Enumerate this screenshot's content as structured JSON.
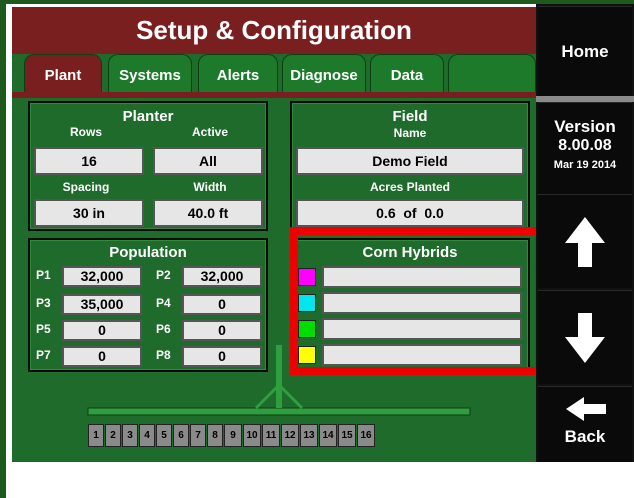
{
  "title": "Setup & Configuration",
  "tabs": [
    {
      "label": "Plant",
      "active": true
    },
    {
      "label": "Systems",
      "active": false
    },
    {
      "label": "Alerts",
      "active": false
    },
    {
      "label": "Diagnose",
      "active": false
    },
    {
      "label": "Data",
      "active": false
    },
    {
      "label": "",
      "active": false
    }
  ],
  "sidebar": {
    "home": "Home",
    "version_label": "Version",
    "version_number": "8.00.08",
    "version_date": "Mar 19 2014",
    "up_icon": "arrow-up-icon",
    "down_icon": "arrow-down-icon",
    "back_icon": "arrow-left-icon",
    "back": "Back"
  },
  "planter": {
    "title": "Planter",
    "rows_label": "Rows",
    "rows_value": "16",
    "active_label": "Active",
    "active_value": "All",
    "spacing_label": "Spacing",
    "spacing_value": "30 in",
    "width_label": "Width",
    "width_value": "40.0 ft"
  },
  "field": {
    "title": "Field",
    "name_label": "Name",
    "name_value": "Demo Field",
    "acres_label": "Acres Planted",
    "acres_value": "0.6  of  0.0"
  },
  "population": {
    "title": "Population",
    "items": [
      {
        "label": "P1",
        "value": "32,000"
      },
      {
        "label": "P2",
        "value": "32,000"
      },
      {
        "label": "P3",
        "value": "35,000"
      },
      {
        "label": "P4",
        "value": "0"
      },
      {
        "label": "P5",
        "value": "0"
      },
      {
        "label": "P6",
        "value": "0"
      },
      {
        "label": "P7",
        "value": "0"
      },
      {
        "label": "P8",
        "value": "0"
      }
    ]
  },
  "hybrids": {
    "title": "Corn Hybrids",
    "items": [
      {
        "color": "#ff00ff",
        "value": ""
      },
      {
        "color": "#00e5ee",
        "value": ""
      },
      {
        "color": "#00dd00",
        "value": ""
      },
      {
        "color": "#ffff00",
        "value": ""
      }
    ]
  },
  "rows": [
    "1",
    "2",
    "3",
    "4",
    "5",
    "6",
    "7",
    "8",
    "9",
    "10",
    "11",
    "12",
    "13",
    "14",
    "15",
    "16"
  ],
  "colors": {
    "panel": "#1f6b2b",
    "title": "#7a1f1f",
    "highlight": "#ee0000"
  }
}
